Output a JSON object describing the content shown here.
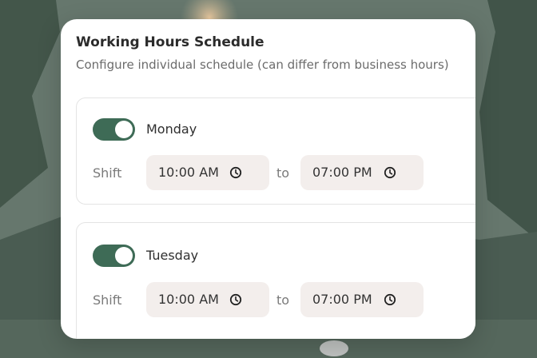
{
  "header": {
    "title": "Working Hours Schedule",
    "subtitle": "Configure individual schedule (can differ from business hours)"
  },
  "days": [
    {
      "name": "Monday",
      "enabled": true,
      "shift_label": "Shift",
      "start_time": "10:00 AM",
      "to_label": "to",
      "end_time": "07:00 PM"
    },
    {
      "name": "Tuesday",
      "enabled": true,
      "shift_label": "Shift",
      "start_time": "10:00 AM",
      "to_label": "to",
      "end_time": "07:00 PM"
    }
  ],
  "icons": {
    "time_field_icon": "clock-icon"
  },
  "colors": {
    "accent": "#3e6b56",
    "field_bg": "#f3eeec"
  }
}
